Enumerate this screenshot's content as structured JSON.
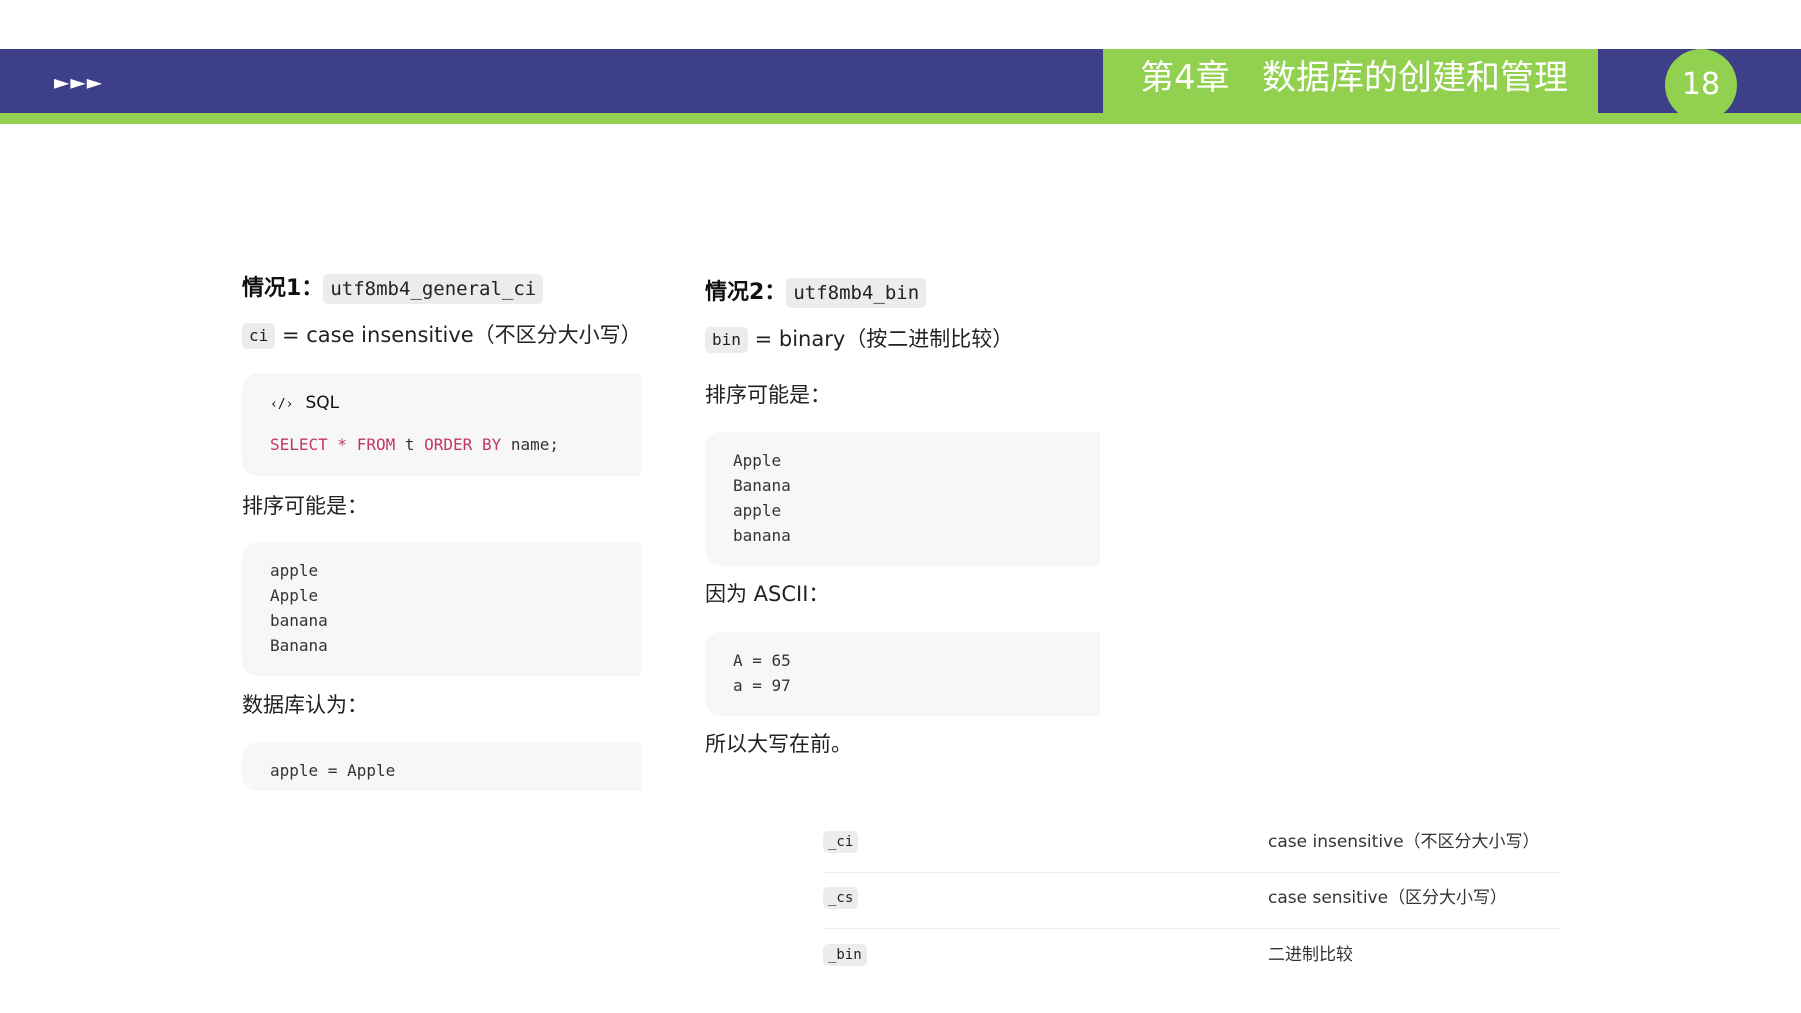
{
  "header": {
    "arrows": "►►►",
    "chapter_title": "第4章   数据库的创建和管理",
    "page_number": "18",
    "colors": {
      "band": "#3d4088",
      "accent": "#92d14f"
    }
  },
  "case1": {
    "heading": "情况1：",
    "collation": "utf8mb4_general_ci",
    "abbr": "ci",
    "abbr_desc": "= case insensitive（不区分大小写）",
    "sql_label": "SQL",
    "sql_icon": "code-icon",
    "sql": {
      "kw1": "SELECT * FROM",
      "t": " t ",
      "kw2": "ORDER BY",
      "rest": " name;"
    },
    "sort_label": "排序可能是：",
    "sort_lines": [
      "apple",
      "Apple",
      "banana",
      "Banana"
    ],
    "db_label": "数据库认为：",
    "db_line": "apple = Apple"
  },
  "case2": {
    "heading": "情况2：",
    "collation": "utf8mb4_bin",
    "abbr": "bin",
    "abbr_desc": "= binary（按二进制比较）",
    "sort_label": "排序可能是：",
    "sort_lines": [
      "Apple",
      "Banana",
      "apple",
      "banana"
    ],
    "ascii_label": "因为 ASCII：",
    "ascii_lines": [
      "A = 65",
      "a = 97"
    ],
    "conclusion": "所以大写在前。"
  },
  "suffix_table": [
    {
      "key": "_ci",
      "desc": "case insensitive（不区分大小写）"
    },
    {
      "key": "_cs",
      "desc": "case sensitive（区分大小写）"
    },
    {
      "key": "_bin",
      "desc": "二进制比较"
    }
  ]
}
